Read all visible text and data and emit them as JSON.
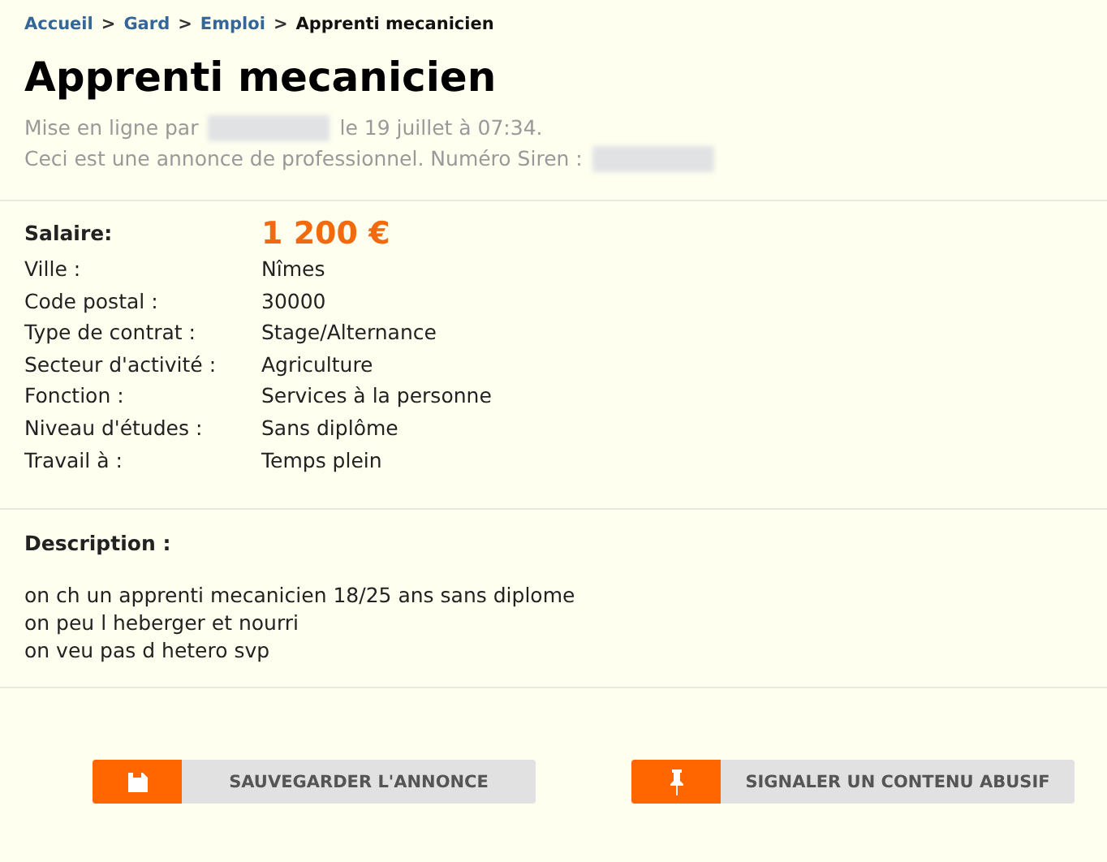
{
  "breadcrumb": [
    {
      "kind": "link",
      "label": "Accueil"
    },
    {
      "kind": "separator",
      "label": ">"
    },
    {
      "kind": "link",
      "label": "Gard"
    },
    {
      "kind": "separator",
      "label": ">"
    },
    {
      "kind": "link",
      "label": "Emploi"
    },
    {
      "kind": "separator",
      "label": ">"
    },
    {
      "kind": "current",
      "label": "Apprenti mecanicien"
    }
  ],
  "title": "Apprenti mecanicien",
  "meta": [
    {
      "before": "Mise en ligne par",
      "after": "le 19 juillet à 07:34."
    },
    {
      "before": "Ceci est une annonce de professionnel. Numéro Siren :"
    }
  ],
  "salary": {
    "label": "Salaire:",
    "value": "1 200 €"
  },
  "details": [
    {
      "label": "Ville :",
      "value": "Nîmes"
    },
    {
      "label": "Code postal :",
      "value": "30000"
    },
    {
      "label": "Type de contrat :",
      "value": "Stage/Alternance"
    },
    {
      "label": "Secteur d'activité :",
      "value": "Agriculture"
    },
    {
      "label": "Fonction :",
      "value": "Services à la personne"
    },
    {
      "label": "Niveau d'études :",
      "value": "Sans diplôme"
    },
    {
      "label": "Travail à :",
      "value": "Temps plein"
    }
  ],
  "description": {
    "heading": "Description :",
    "lines": [
      "on ch un apprenti mecanicien 18/25 ans sans diplome",
      "on peu l heberger et nourri",
      "on veu pas d hetero svp"
    ]
  },
  "actions": [
    {
      "kind": "save",
      "label": "SAUVEGARDER L'ANNONCE"
    },
    {
      "kind": "report",
      "label": "SIGNALER UN CONTENU ABUSIF"
    }
  ]
}
